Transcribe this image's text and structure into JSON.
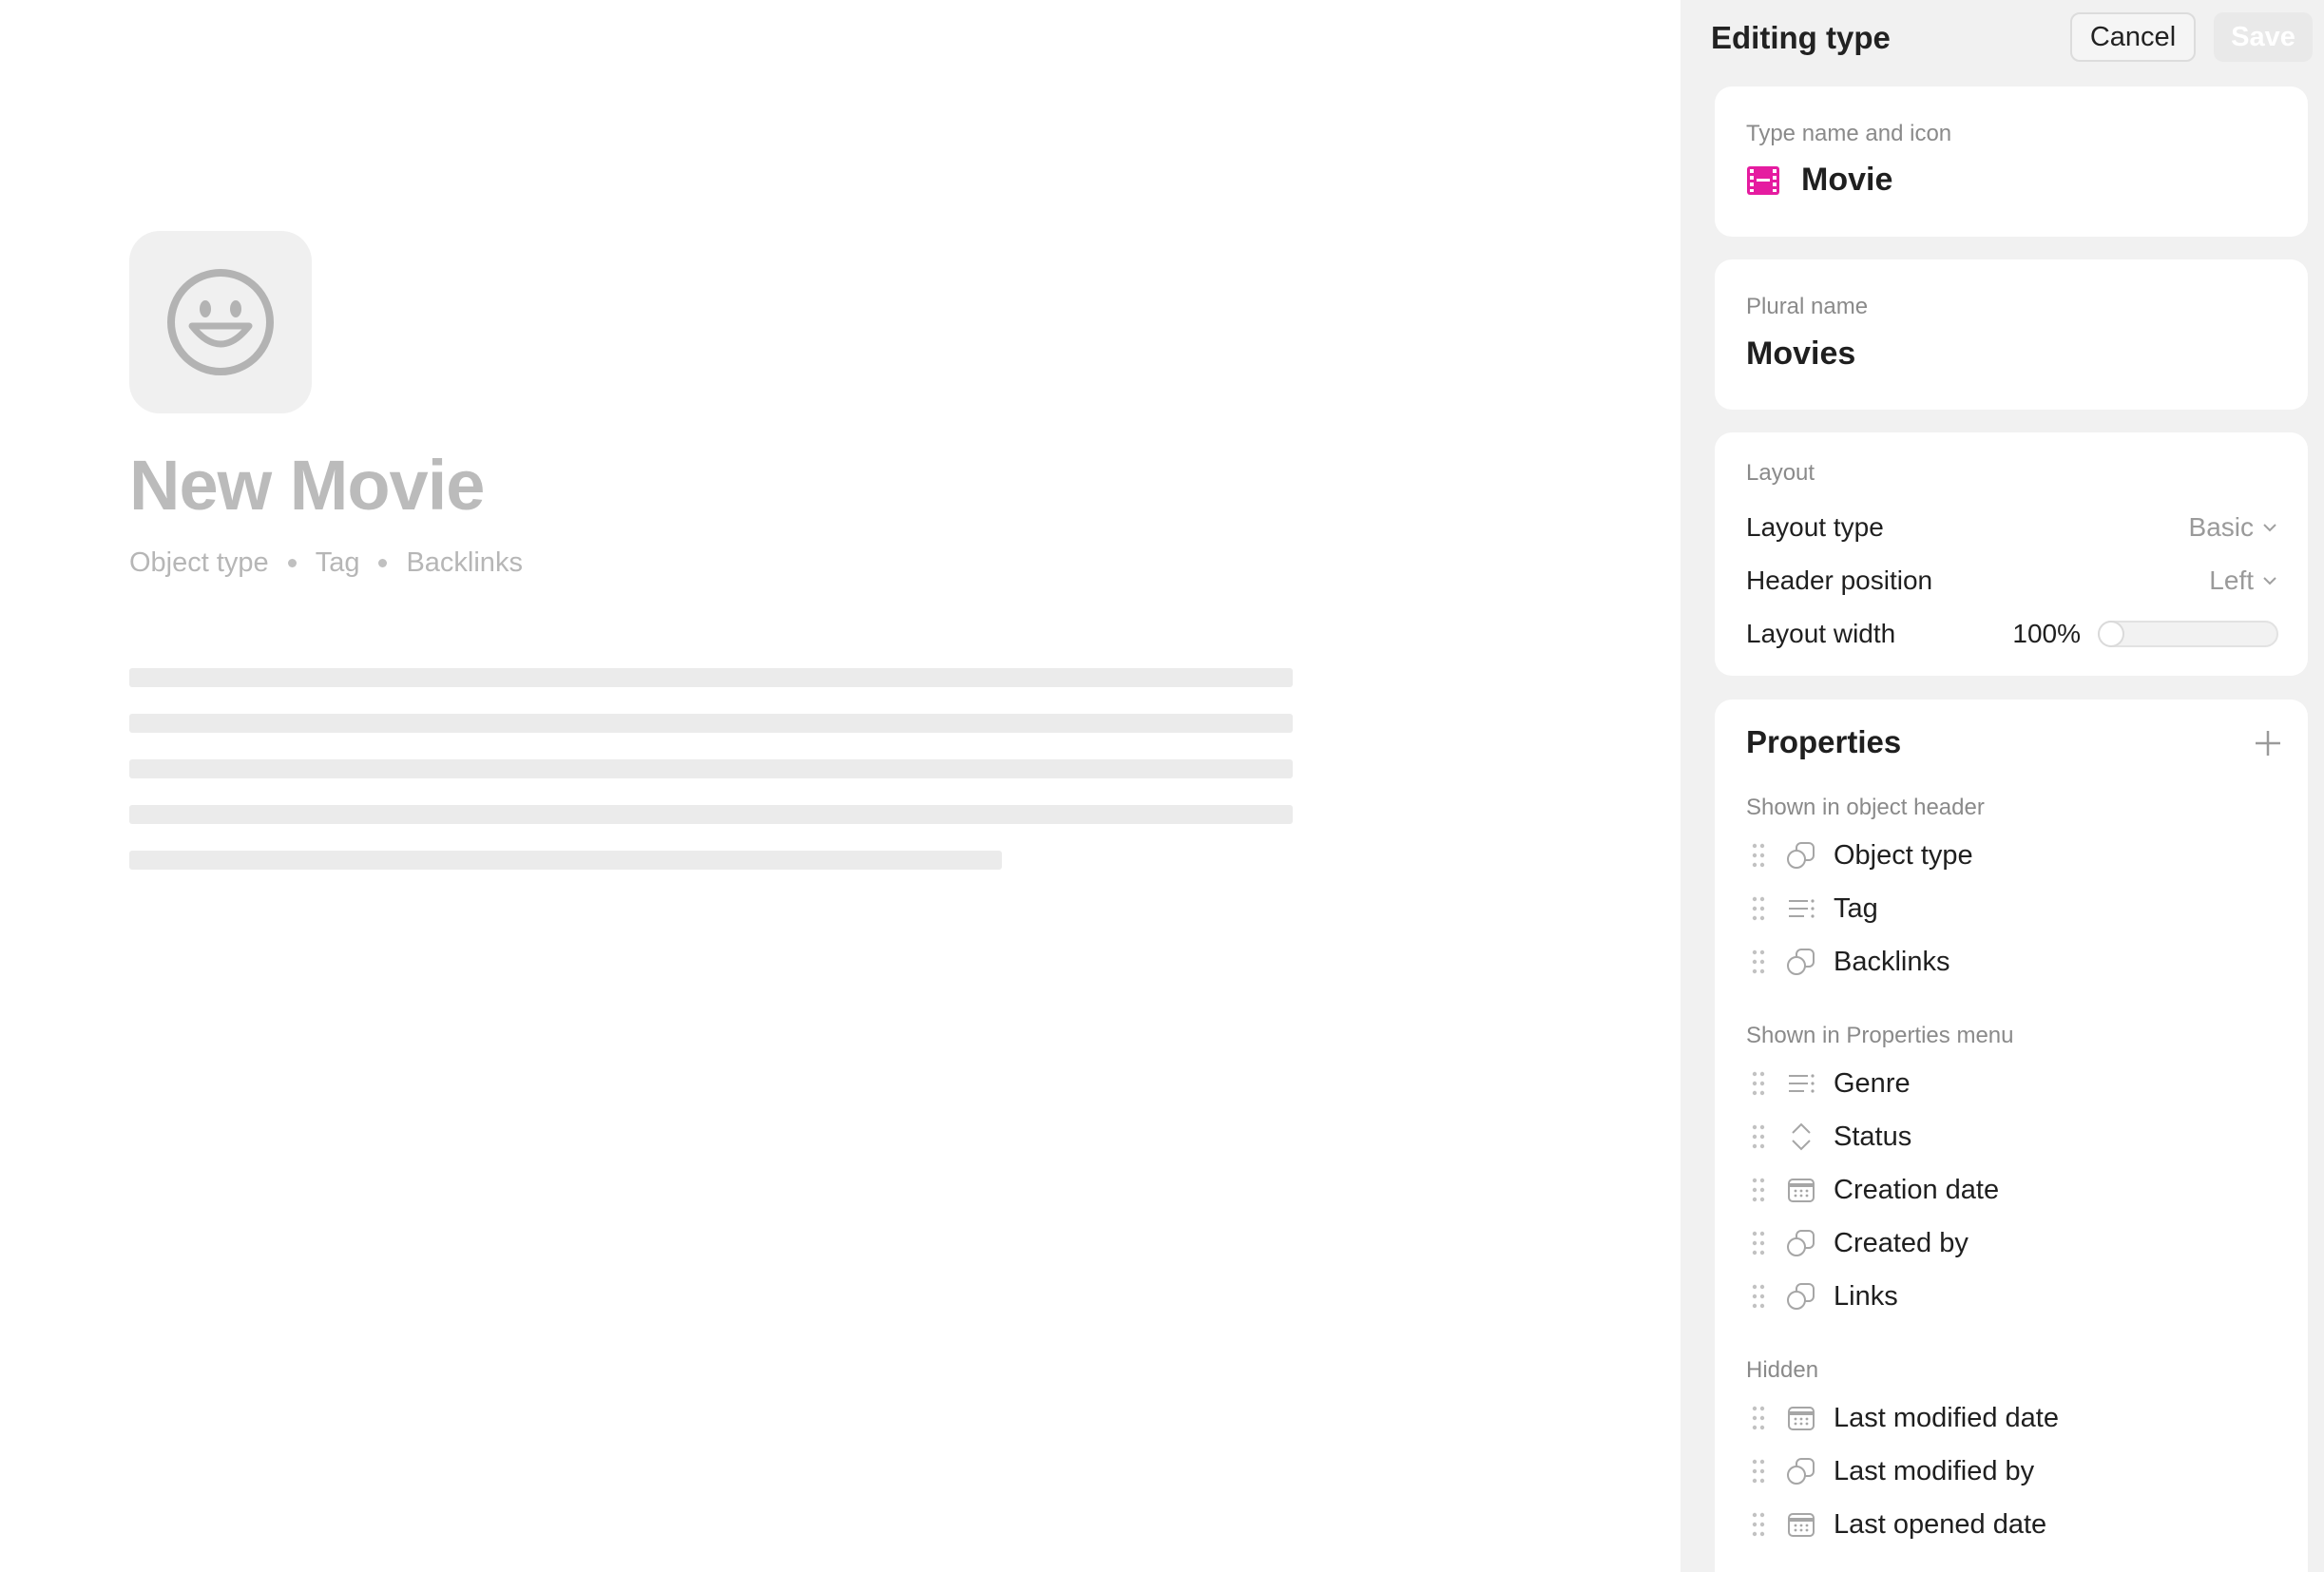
{
  "object": {
    "icon": "smiley-face-icon",
    "title": "New Movie",
    "meta": [
      "Object type",
      "Tag",
      "Backlinks"
    ]
  },
  "panel": {
    "title": "Editing type",
    "cancel_label": "Cancel",
    "save_label": "Save",
    "type_name": {
      "label": "Type name and icon",
      "icon": "film-icon",
      "icon_color": "#e51ca0",
      "value": "Movie"
    },
    "plural": {
      "label": "Plural name",
      "value": "Movies"
    },
    "layout": {
      "label": "Layout",
      "layout_type_label": "Layout type",
      "layout_type_value": "Basic",
      "header_position_label": "Header position",
      "header_position_value": "Left",
      "layout_width_label": "Layout width",
      "layout_width_value": "100%"
    },
    "properties": {
      "title": "Properties",
      "header_section": "Shown in object header",
      "header_items": [
        {
          "name": "Object type",
          "icon": "relation-object-icon"
        },
        {
          "name": "Tag",
          "icon": "tag-list-icon"
        },
        {
          "name": "Backlinks",
          "icon": "relation-object-icon"
        }
      ],
      "menu_section": "Shown in Properties menu",
      "menu_items": [
        {
          "name": "Genre",
          "icon": "tag-list-icon"
        },
        {
          "name": "Status",
          "icon": "status-select-icon"
        },
        {
          "name": "Creation date",
          "icon": "calendar-icon"
        },
        {
          "name": "Created by",
          "icon": "relation-object-icon"
        },
        {
          "name": "Links",
          "icon": "relation-object-icon"
        }
      ],
      "hidden_section": "Hidden",
      "hidden_items": [
        {
          "name": "Last modified date",
          "icon": "calendar-icon"
        },
        {
          "name": "Last modified by",
          "icon": "relation-object-icon"
        },
        {
          "name": "Last opened date",
          "icon": "calendar-icon"
        }
      ]
    }
  }
}
